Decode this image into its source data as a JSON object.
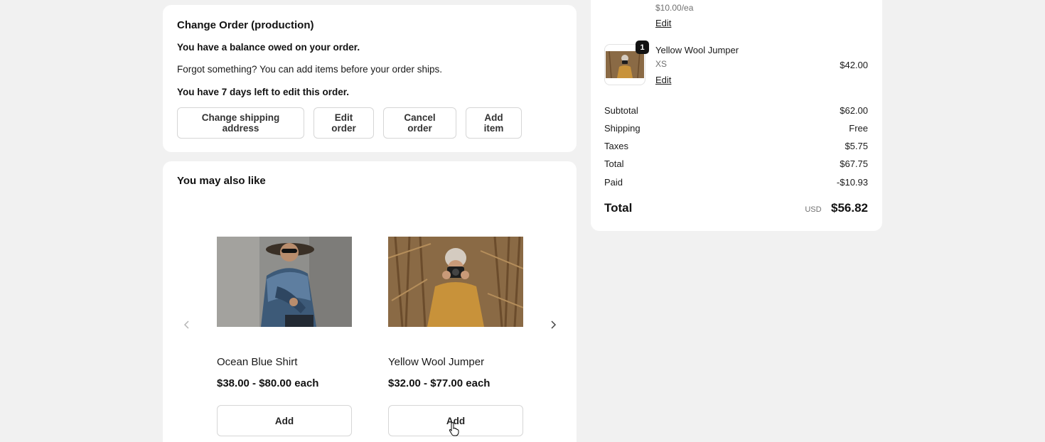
{
  "change_order": {
    "title": "Change Order (production)",
    "balance_text": "You have a balance owed on your order.",
    "forgot_text": "Forgot something? You can add items before your order ships.",
    "days_text": "You have 7 days left to edit this order.",
    "buttons": [
      "Change shipping address",
      "Edit order",
      "Cancel order",
      "Add item"
    ]
  },
  "recommendations": {
    "title": "You may also like",
    "products": [
      {
        "name": "Ocean Blue Shirt",
        "price": "$38.00 - $80.00 each",
        "add_label": "Add"
      },
      {
        "name": "Yellow Wool Jumper",
        "price": "$32.00 - $77.00 each",
        "add_label": "Add"
      }
    ]
  },
  "summary": {
    "prev_item_unit_price": "$10.00/ea",
    "prev_item_edit": "Edit",
    "line_item": {
      "quantity": "1",
      "name": "Yellow Wool Jumper",
      "variant": "XS",
      "edit": "Edit",
      "price": "$42.00"
    },
    "rows": [
      {
        "label": "Subtotal",
        "value": "$62.00"
      },
      {
        "label": "Shipping",
        "value": "Free"
      },
      {
        "label": "Taxes",
        "value": "$5.75"
      },
      {
        "label": "Total",
        "value": "$67.75"
      },
      {
        "label": "Paid",
        "value": "-$10.93"
      }
    ],
    "total_label": "Total",
    "total_currency": "USD",
    "total_amount": "$56.82"
  },
  "icons": [
    "chevron-left-icon",
    "chevron-right-icon",
    "pointer-cursor-icon"
  ]
}
